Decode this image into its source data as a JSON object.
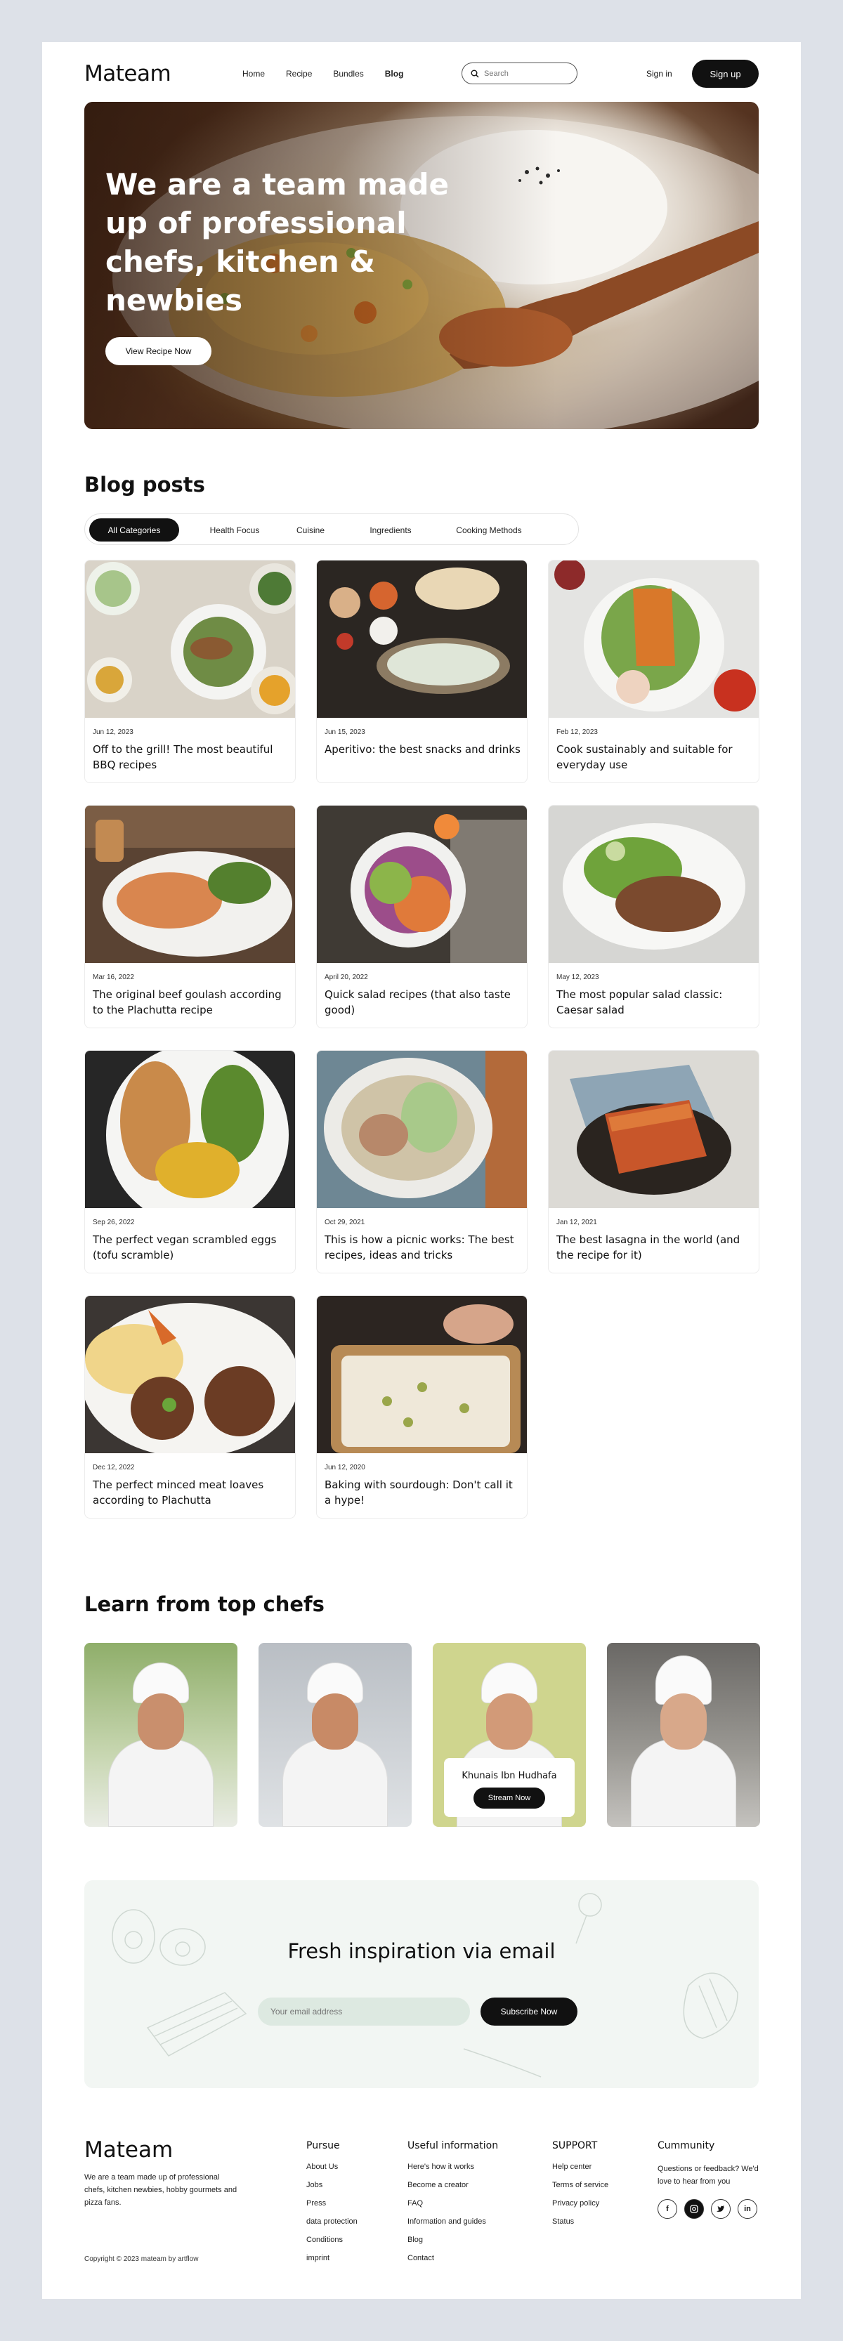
{
  "brand": "Mateam",
  "nav": {
    "links": [
      "Home",
      "Recipe",
      "Bundles",
      "Blog"
    ],
    "active": "Blog",
    "search_placeholder": "Search",
    "signin": "Sign in",
    "signup": "Sign up"
  },
  "hero": {
    "title": "We are a team made up of professional chefs, kitchen & newbies",
    "button": "View Recipe Now"
  },
  "blog": {
    "title": "Blog posts",
    "tabs": [
      "All Categories",
      "Health Focus",
      "Cuisine",
      "Ingredients",
      "Cooking Methods"
    ],
    "active_tab": "All Categories",
    "posts": [
      {
        "date": "Jun 12, 2023",
        "title": "Off to the grill! The most beautiful BBQ recipes"
      },
      {
        "date": "Jun 15, 2023",
        "title": "Aperitivo: the best snacks and drinks"
      },
      {
        "date": "Feb 12, 2023",
        "title": "Cook sustainably and suitable for everyday use"
      },
      {
        "date": "Mar 16, 2022",
        "title": "The original beef goulash according to the Plachutta recipe"
      },
      {
        "date": "April 20, 2022",
        "title": "Quick salad recipes (that also taste good)"
      },
      {
        "date": "May 12, 2023",
        "title": "The most popular salad classic: Caesar salad"
      },
      {
        "date": "Sep 26, 2022",
        "title": "The perfect vegan scrambled eggs (tofu scramble)"
      },
      {
        "date": "Oct 29, 2021",
        "title": "This is how a picnic works: The best recipes, ideas and tricks"
      },
      {
        "date": "Jan 12, 2021",
        "title": "The best lasagna in the world (and the recipe for it)"
      },
      {
        "date": "Dec 12, 2022",
        "title": "The perfect minced meat loaves according to Plachutta"
      },
      {
        "date": "Jun 12, 2020",
        "title": "Baking with sourdough: Don't call it a hype!"
      }
    ]
  },
  "chefs": {
    "title": "Learn from top chefs",
    "featured_name": "Khunais Ibn Hudhafa",
    "stream_button": "Stream Now"
  },
  "newsletter": {
    "title": "Fresh inspiration via email",
    "placeholder": "Your email address",
    "button": "Subscribe Now"
  },
  "footer": {
    "description": "We are a team made up of professional chefs, kitchen newbies, hobby gourmets and pizza fans.",
    "copyright": "Copyright © 2023 mateam by artflow",
    "columns": [
      {
        "title": "Pursue",
        "links": [
          "About Us",
          "Jobs",
          "Press",
          "data protection",
          "Conditions",
          "imprint"
        ]
      },
      {
        "title": "Useful information",
        "links": [
          "Here's how it works",
          "Become a creator",
          "FAQ",
          "Information and guides",
          "Blog",
          "Contact"
        ]
      },
      {
        "title": "SUPPORT",
        "links": [
          "Help center",
          "Terms of service",
          "Privacy policy",
          "Status"
        ]
      }
    ],
    "community": {
      "title": "Cummunity",
      "text": "Questions or feedback? We'd love to hear from you",
      "socials": [
        "facebook-icon",
        "instagram-icon",
        "twitter-icon",
        "linkedin-icon"
      ]
    }
  }
}
